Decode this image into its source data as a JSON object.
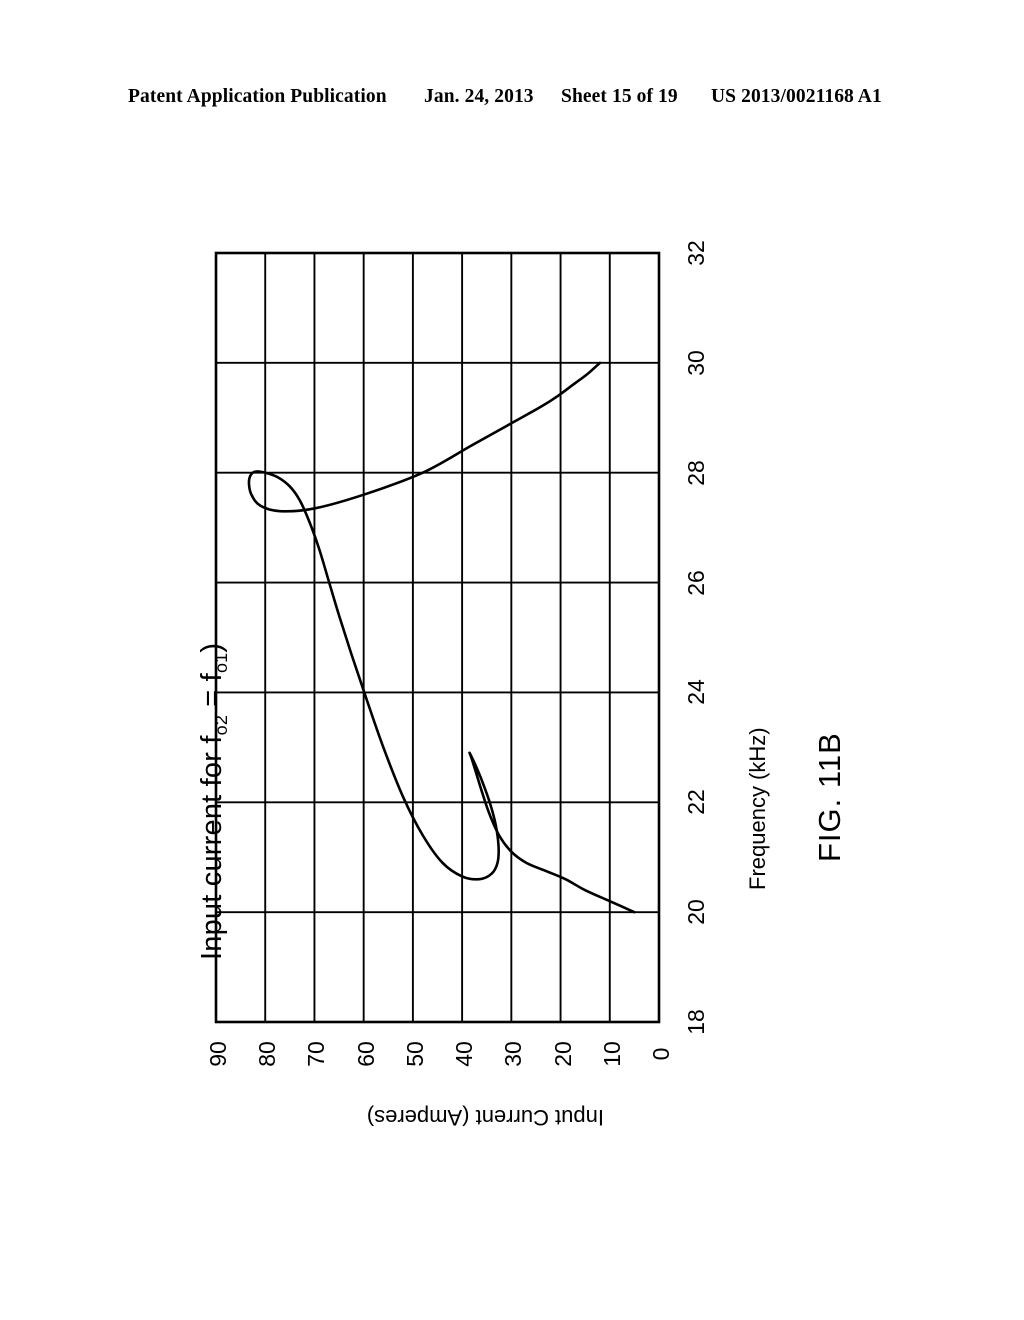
{
  "header": {
    "publication": "Patent Application Publication",
    "date": "Jan. 24, 2013",
    "sheet": "Sheet 15 of 19",
    "number": "US 2013/0021168 A1"
  },
  "figure": {
    "caption": "FIG. 11B"
  },
  "chart_data": {
    "type": "line",
    "title": "Input current for f_o2 = f_o1 )",
    "title_parts": {
      "prefix": "Input current for f",
      "sub1": "o2",
      "middle": " = f",
      "sub2": "o1",
      "suffix": ")"
    },
    "xlabel": "Frequency (kHz)",
    "ylabel": "Input Current (Amperes)",
    "xlim": [
      18,
      32
    ],
    "ylim": [
      0,
      90
    ],
    "xticks": [
      18,
      20,
      22,
      24,
      26,
      28,
      30,
      32
    ],
    "yticks": [
      0,
      10,
      20,
      30,
      40,
      50,
      60,
      70,
      80,
      90
    ],
    "xtick_labels": [
      "18",
      "20",
      "22",
      "24",
      "26",
      "28",
      "30",
      "32"
    ],
    "ytick_labels": [
      "90",
      "80",
      "70",
      "60",
      "50",
      "40",
      "30",
      "20",
      "10",
      "0"
    ],
    "grid": true,
    "legend": false,
    "rotated_90deg": true,
    "line_color": "#000000",
    "grid_color": "#000000",
    "series": [
      {
        "name": "Input current",
        "x": [
          20.0,
          20.2,
          20.4,
          20.6,
          20.75,
          20.9,
          21.1,
          21.4,
          21.8,
          22.2,
          22.55,
          22.78,
          22.88,
          22.9,
          22.85,
          22.7,
          22.4,
          22.0,
          21.6,
          21.2,
          20.9,
          20.7,
          20.6,
          20.65,
          20.9,
          21.4,
          22.1,
          23.0,
          23.9,
          24.7,
          25.4,
          26.0,
          26.6,
          27.1,
          27.5,
          27.75,
          27.92,
          28.0,
          28.02,
          27.95,
          27.8,
          27.6,
          27.4,
          27.3,
          27.35,
          27.6,
          28.0,
          28.5,
          28.9,
          29.2,
          29.4,
          29.6,
          29.8,
          30.0
        ],
        "y": [
          5,
          10,
          15,
          19,
          23,
          27,
          30,
          32.5,
          34.5,
          36,
          37.2,
          38.0,
          38.4,
          38.5,
          38.2,
          37.4,
          36.0,
          34.4,
          33.2,
          32.6,
          32.8,
          34.0,
          36.5,
          40.0,
          44.0,
          48.0,
          52.0,
          56.0,
          59.5,
          62.5,
          65.0,
          67.0,
          69.0,
          71.0,
          73.0,
          75.0,
          77.5,
          80.0,
          82.0,
          83.0,
          83.3,
          82.8,
          81.0,
          77.0,
          70.0,
          60.0,
          48.0,
          38.0,
          30.0,
          24.0,
          20.5,
          17.5,
          14.5,
          12.0
        ]
      }
    ]
  }
}
